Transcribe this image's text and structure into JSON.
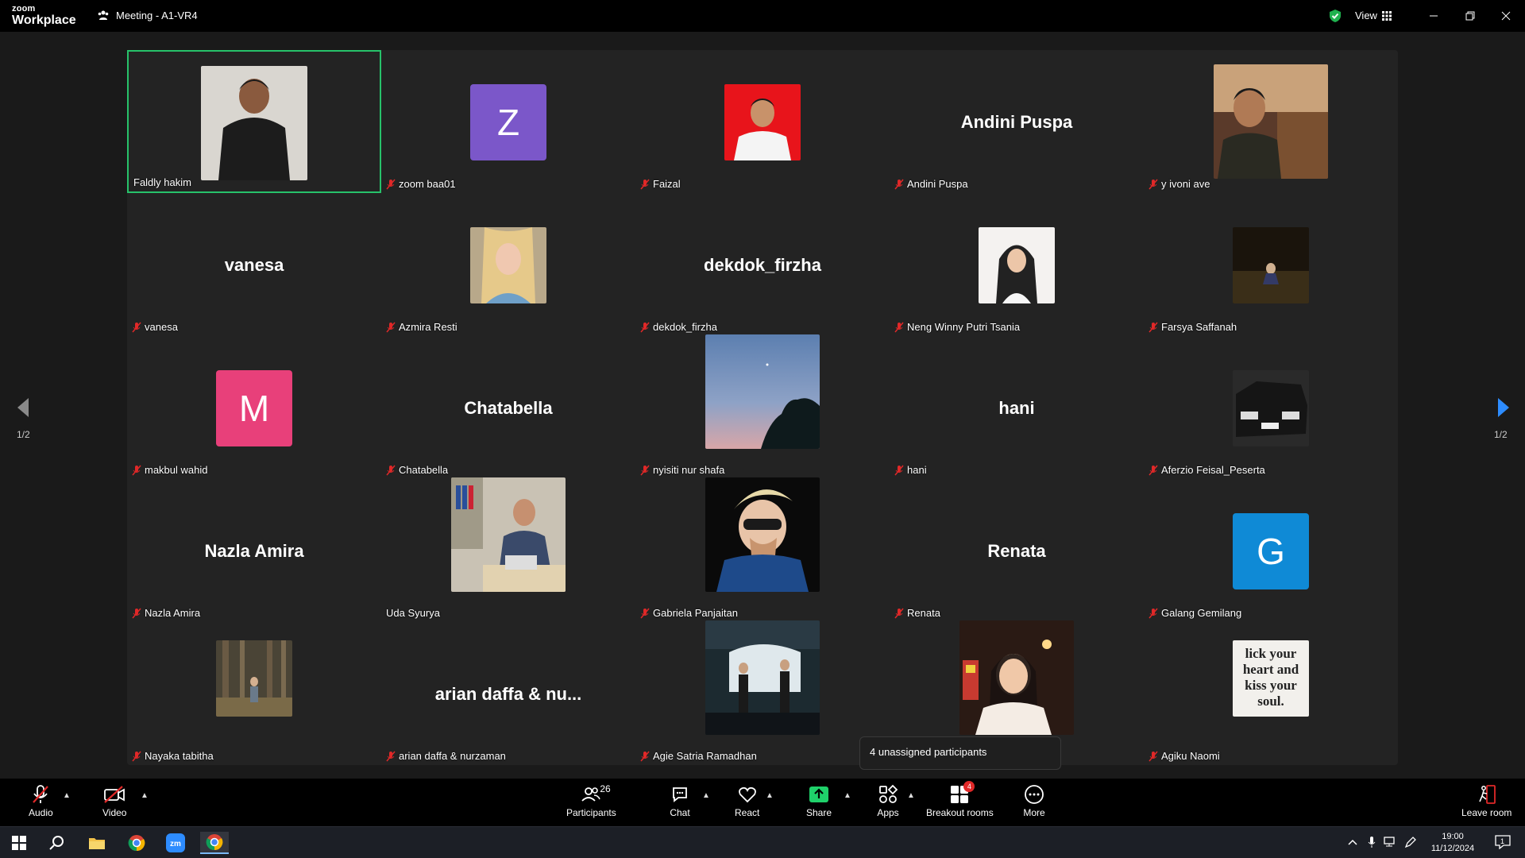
{
  "app": {
    "logo_line1": "zoom",
    "logo_line2": "Workplace",
    "meeting_title": "Meeting - A1-VR4",
    "view_label": "View"
  },
  "colors": {
    "active_border": "#27c26a",
    "mute_red": "#e02828",
    "gallery_bg": "#232323",
    "nav_arrow_right": "#2d8cff"
  },
  "participants": [
    {
      "name": "Faldly hakim",
      "display": "photo",
      "muted": false,
      "active": true
    },
    {
      "name": "zoom baa01",
      "display": "letter",
      "letter": "Z",
      "color": "#7b57c9",
      "muted": true
    },
    {
      "name": "Faizal",
      "display": "photo",
      "muted": true
    },
    {
      "name": "Andini Puspa",
      "display": "name",
      "big_name": "Andini Puspa",
      "muted": true
    },
    {
      "name": "y ivoni ave",
      "display": "photo",
      "muted": true
    },
    {
      "name": "vanesa",
      "display": "name",
      "big_name": "vanesa",
      "muted": true
    },
    {
      "name": "Azmira Resti",
      "display": "photo",
      "muted": true
    },
    {
      "name": "dekdok_firzha",
      "display": "name",
      "big_name": "dekdok_firzha",
      "muted": true
    },
    {
      "name": "Neng Winny Putri Tsania",
      "display": "photo",
      "muted": true
    },
    {
      "name": "Farsya Saffanah",
      "display": "photo",
      "muted": true
    },
    {
      "name": "makbul wahid",
      "display": "letter",
      "letter": "M",
      "color": "#e8407a",
      "muted": true
    },
    {
      "name": "Chatabella",
      "display": "name",
      "big_name": "Chatabella",
      "muted": true
    },
    {
      "name": "nyisiti nur shafa",
      "display": "photo",
      "muted": true
    },
    {
      "name": "hani",
      "display": "name",
      "big_name": "hani",
      "muted": true
    },
    {
      "name": "Aferzio Feisal_Peserta",
      "display": "photo",
      "muted": true
    },
    {
      "name": "Nazla Amira",
      "display": "name",
      "big_name": "Nazla Amira",
      "muted": true
    },
    {
      "name": "Uda Syurya",
      "display": "photo",
      "muted": false
    },
    {
      "name": "Gabriela Panjaitan",
      "display": "photo",
      "muted": true
    },
    {
      "name": "Renata",
      "display": "name",
      "big_name": "Renata",
      "muted": true
    },
    {
      "name": "Galang Gemilang",
      "display": "letter",
      "letter": "G",
      "color": "#0f8ad6",
      "muted": true
    },
    {
      "name": "Nayaka tabitha",
      "display": "photo",
      "muted": true
    },
    {
      "name": "arian daffa & nurzaman",
      "display": "name",
      "big_name": "arian daffa & nu...",
      "muted": true
    },
    {
      "name": "Agie Satria Ramadhan",
      "display": "photo",
      "muted": true
    },
    {
      "name": "",
      "display": "photo",
      "muted": false
    },
    {
      "name": "Agiku Naomi",
      "display": "photo",
      "muted": true
    }
  ],
  "pagination": {
    "left": "1/2",
    "right": "1/2"
  },
  "tooltip": "4 unassigned participants",
  "toolbar": {
    "audio": "Audio",
    "video": "Video",
    "participants": "Participants",
    "participants_count": "26",
    "chat": "Chat",
    "react": "React",
    "share": "Share",
    "apps": "Apps",
    "breakout": "Breakout rooms",
    "breakout_badge": "4",
    "more": "More",
    "leave": "Leave room"
  },
  "taskbar": {
    "time": "19:00",
    "date": "11/12/2024",
    "notif_count": "1"
  }
}
